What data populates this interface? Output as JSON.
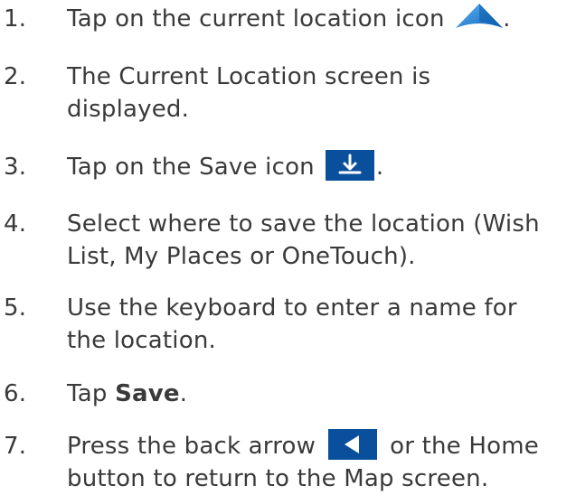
{
  "steps": [
    {
      "number": "1.",
      "before_icon": "Tap on the current location icon ",
      "icon": "current-location-icon",
      "after_icon": "."
    },
    {
      "number": "2.",
      "line1": "The Current Location screen is",
      "line2": "displayed."
    },
    {
      "number": "3.",
      "before_icon": "Tap on the Save icon",
      "icon": "save-icon",
      "after_icon": "."
    },
    {
      "number": "4.",
      "line1": "Select where to save the location (Wish",
      "line2": "List, My Places or OneTouch)."
    },
    {
      "number": "5.",
      "line1": "Use the keyboard to enter a name for",
      "line2": "the location."
    },
    {
      "number": "6.",
      "prefix": "Tap ",
      "bold": "Save",
      "suffix": "."
    },
    {
      "number": "7.",
      "before_icon": "Press the back arrow",
      "icon": "back-arrow-icon",
      "after_icon": "or the Home",
      "line2": "button to return to the Map screen."
    }
  ],
  "colors": {
    "text": "#3a3a3a",
    "icon_background": "#0a4f9c",
    "location_icon_blue": "#1b7fd6",
    "icon_foreground": "#ffffff"
  }
}
